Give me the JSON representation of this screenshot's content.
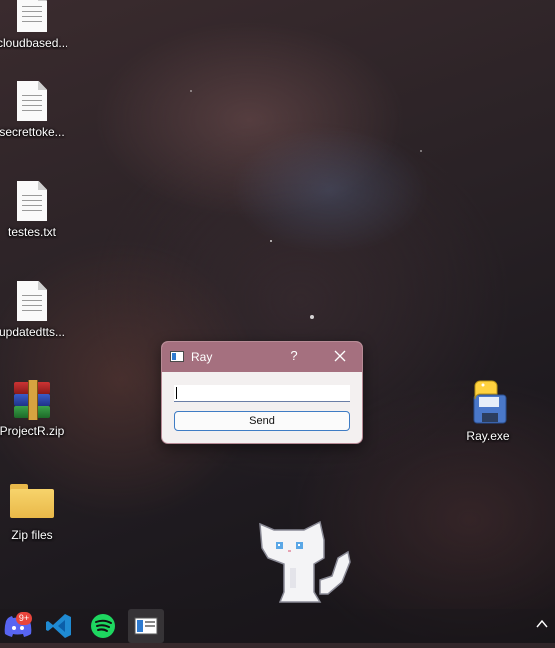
{
  "desktop": {
    "icons": [
      {
        "label": "cloudbased...",
        "kind": "text-file"
      },
      {
        "label": "secrettoke...",
        "kind": "text-file"
      },
      {
        "label": "testes.txt",
        "kind": "text-file"
      },
      {
        "label": "updatedtts...",
        "kind": "text-file"
      },
      {
        "label": "ProjectR.zip",
        "kind": "winrar-archive"
      },
      {
        "label": "Zip files",
        "kind": "folder"
      },
      {
        "label": "Ray.exe",
        "kind": "python-executable"
      }
    ]
  },
  "dialog": {
    "title": "Ray",
    "help_label": "?",
    "input_value": "",
    "send_label": "Send"
  },
  "taskbar": {
    "apps": [
      {
        "name": "discord-icon",
        "badge": "9+"
      },
      {
        "name": "vscode-icon"
      },
      {
        "name": "spotify-icon"
      },
      {
        "name": "ray-app-icon",
        "active": true
      }
    ]
  },
  "colors": {
    "titlebar": "#a5707f",
    "send_border": "#3f7cc4",
    "badge": "#e8453c"
  }
}
